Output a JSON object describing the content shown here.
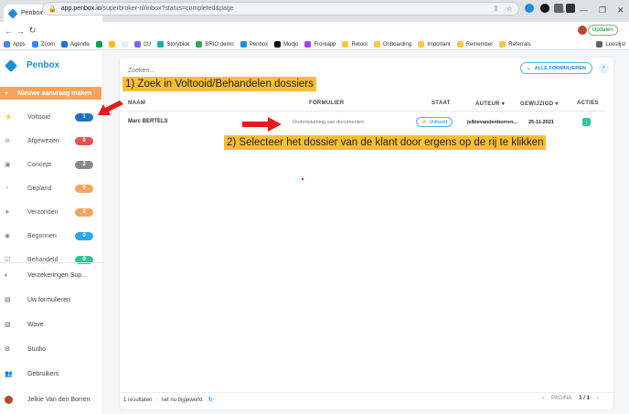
{
  "browser": {
    "tab_title": "Penbox",
    "url_host": "app.penbox.io",
    "url_path": "/superbroker-nl/inbox?status=completed&page",
    "update_label": "Updaten",
    "bookmarks": [
      {
        "label": "Apps",
        "color": "#4285f4"
      },
      {
        "label": "Zoom",
        "color": "#2d8cff"
      },
      {
        "label": "Agenda",
        "color": "#1a73e8"
      },
      {
        "label": "",
        "color": "#0f9d58"
      },
      {
        "label": "",
        "color": "#fbbc04"
      },
      {
        "label": "",
        "color": "#e8eaed"
      },
      {
        "label": "CU",
        "color": "#7b68ee"
      },
      {
        "label": "Storyblok",
        "color": "#09b3af"
      },
      {
        "label": "BRIO demo",
        "color": "#34a853"
      },
      {
        "label": "Penbox",
        "color": "#1a8fd8"
      },
      {
        "label": "Modjo",
        "color": "#111111"
      },
      {
        "label": "Frontapp",
        "color": "#a142f4"
      },
      {
        "label": "Retool",
        "color": "#f2c94c"
      },
      {
        "label": "Onboarding",
        "color": "#f2c94c"
      },
      {
        "label": "Important",
        "color": "#f2c94c"
      },
      {
        "label": "Remember",
        "color": "#f2c94c"
      },
      {
        "label": "Referrals",
        "color": "#f2c94c"
      }
    ],
    "reading_list": "Leeslijst"
  },
  "sidebar": {
    "brand": "Penbox",
    "new_request": "Nieuwe aanvraag maken",
    "statuses": [
      {
        "label": "Voltooid",
        "count": "1",
        "color": "#1a73c9",
        "icon": "bolt-icon",
        "glyph": "⚡"
      },
      {
        "label": "Afgewezen",
        "count": "0",
        "color": "#e55353",
        "icon": "ban-icon",
        "glyph": "⊘"
      },
      {
        "label": "Concept",
        "count": "2",
        "color": "#8a8a8a",
        "icon": "save-icon",
        "glyph": "▣"
      },
      {
        "label": "Gepland",
        "count": "0",
        "color": "#f7a35c",
        "icon": "clock-icon",
        "glyph": "◔"
      },
      {
        "label": "Verzonden",
        "count": "2",
        "color": "#f7a35c",
        "icon": "send-icon",
        "glyph": "➤"
      },
      {
        "label": "Begonnen",
        "count": "0",
        "color": "#2ea6e6",
        "icon": "play-icon",
        "glyph": "◉"
      },
      {
        "label": "Behandeld",
        "count": "0",
        "color": "#2ec99b",
        "icon": "check-icon",
        "glyph": "☑"
      }
    ],
    "links": [
      {
        "label": "Verzekeringen Sup...",
        "icon": "company-logo-icon",
        "glyph": "◐"
      },
      {
        "label": "Uw formulieren",
        "icon": "forms-icon",
        "glyph": "▤"
      },
      {
        "label": "Wave",
        "icon": "wave-icon",
        "glyph": "▧"
      },
      {
        "label": "Studio",
        "icon": "studio-icon",
        "glyph": "⚙"
      },
      {
        "label": "Gebruikers",
        "icon": "users-icon",
        "glyph": "👥"
      }
    ],
    "user": "Jelkie Van den Borren"
  },
  "main": {
    "search_placeholder": "Zoeken...",
    "all_forms": "ALLE FORMULIEREN",
    "columns": {
      "name": "NAAM",
      "form": "FORMULIER",
      "status": "STAAT",
      "author": "AUTEUR",
      "modified": "GEWIJZIGD",
      "actions": "ACTIES"
    },
    "rows": [
      {
        "name": "Marc BERTELS",
        "form": "Ondertekening van documenten",
        "status": "Voltooid",
        "author": "jelkievandenborren...",
        "modified": "25-11-2021"
      }
    ],
    "results": "1 resultaten",
    "updated": "net nu bijgewerkt",
    "page_label": "PAGINA",
    "page_value": "1 / 1"
  },
  "annotations": {
    "step1": "1) Zoek in Voltooid/Behandelen dossiers",
    "step2": "2) Selecteer het dossier van de klant door ergens op de rij te klikken",
    "color": "#fbbf2f",
    "arrow_color": "#e31b1b"
  }
}
